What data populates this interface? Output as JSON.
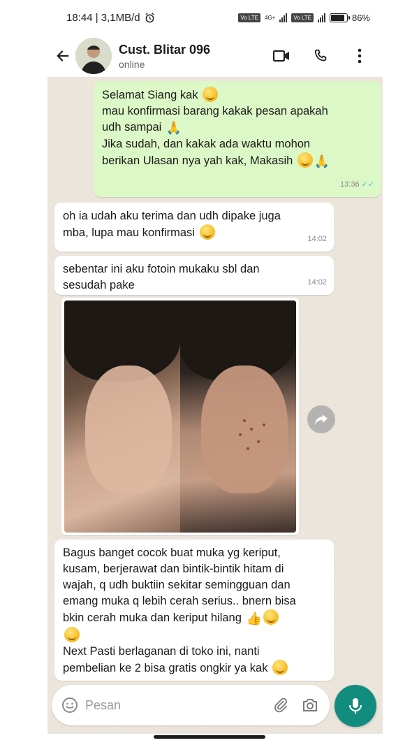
{
  "status_bar": {
    "time_info": "18:44 | 3,1MB/d",
    "network_tag_1": "Vo LTE",
    "network_tag_2": "4G+",
    "network_tag_3": "Vo LTE",
    "battery": "86%",
    "battery_level": 0.86
  },
  "header": {
    "contact_name": "Cust. Blitar 096",
    "contact_status": "online"
  },
  "messages": [
    {
      "direction": "outgoing",
      "lines": [
        "Selamat Siang kak",
        "mau konfirmasi barang kakak pesan apakah",
        "udh sampai",
        "Jika sudah, dan kakak ada waktu mohon",
        "berikan Ulasan nya yah kak, Makasih"
      ],
      "time": "13:36",
      "read": "✓✓"
    },
    {
      "direction": "incoming",
      "lines": [
        "oh ia udah aku terima dan udh dipake juga",
        "mba, lupa mau konfirmasi"
      ],
      "time": "14:02"
    },
    {
      "direction": "incoming",
      "lines": [
        "sebentar ini aku fotoin mukaku sbl  dan",
        "sesudah pake"
      ],
      "time": "14:02"
    },
    {
      "direction": "incoming",
      "lines": [
        "Bagus banget cocok buat muka yg keriput,",
        "kusam, berjerawat dan bintik-bintik hitam di",
        "wajah, q udh buktiin sekitar semingguan dan",
        "emang muka q lebih cerah serius.. bnern bisa",
        "bkin cerah muka dan keriput hilang",
        "",
        "Next Pasti berlaganan di toko ini, nanti",
        "pembelian ke 2 bisa gratis ongkir ya kak"
      ]
    }
  ],
  "input": {
    "placeholder": "Pesan"
  },
  "icons": {
    "back": "back-arrow-icon",
    "video": "video-call-icon",
    "call": "phone-call-icon",
    "menu": "more-vertical-icon",
    "share": "forward-share-icon",
    "emoji": "emoji-icon",
    "attach": "paperclip-icon",
    "camera": "camera-icon",
    "mic": "microphone-icon"
  },
  "colors": {
    "outgoing_bubble": "#dcf8c6",
    "incoming_bubble": "#ffffff",
    "accent": "#128c7e",
    "chat_background": "#ebe5dc"
  }
}
